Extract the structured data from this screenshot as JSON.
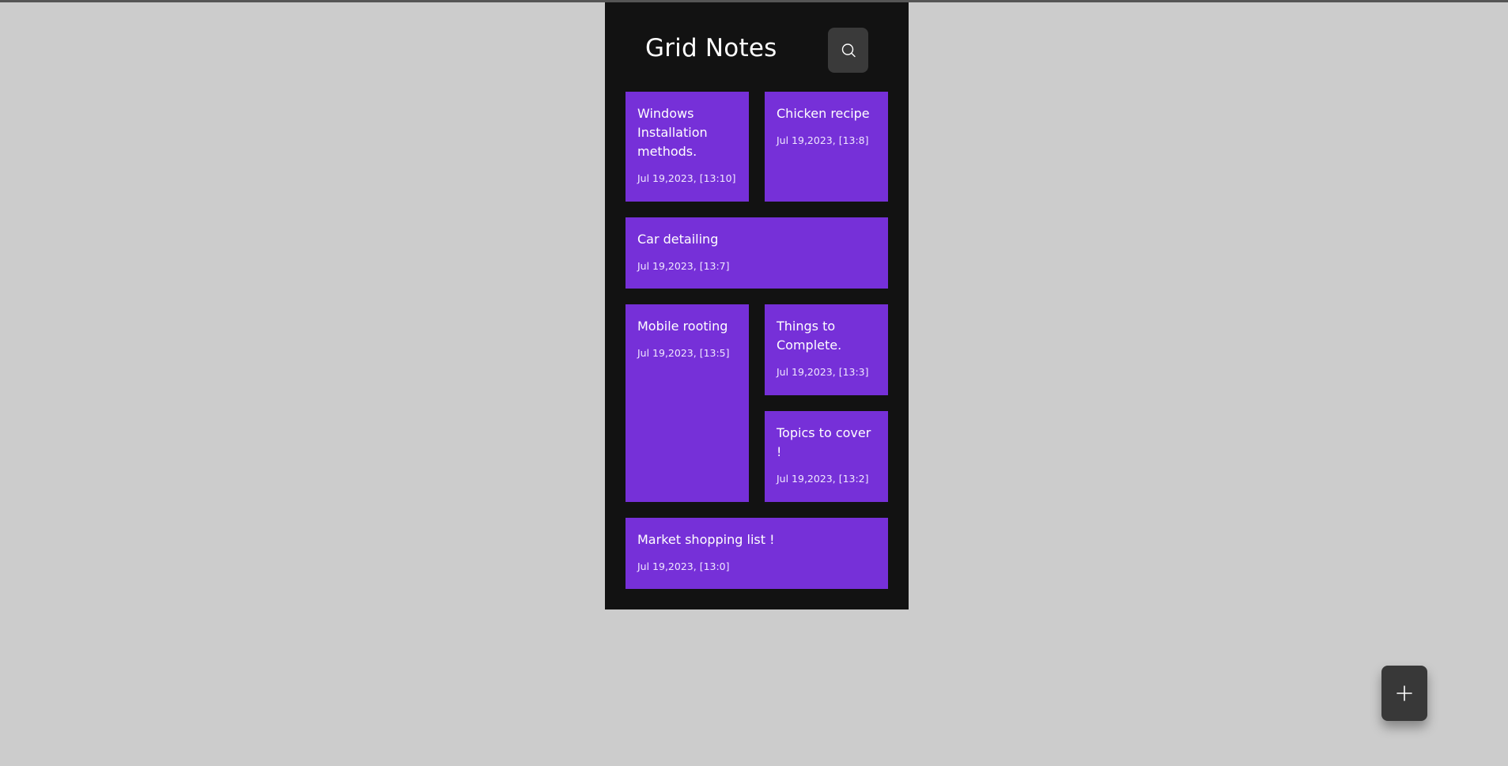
{
  "app": {
    "title": "Grid Notes"
  },
  "header": {
    "search_icon": "search-icon"
  },
  "notes": [
    {
      "title": "Windows Installation methods.",
      "date": "Jul 19,2023, [13:10]"
    },
    {
      "title": "Chicken recipe",
      "date": "Jul 19,2023, [13:8]"
    },
    {
      "title": "Car detailing",
      "date": "Jul 19,2023, [13:7]"
    },
    {
      "title": "Mobile rooting",
      "date": "Jul 19,2023, [13:5]"
    },
    {
      "title": "Things to Complete.",
      "date": "Jul 19,2023, [13:3]"
    },
    {
      "title": "Topics to cover !",
      "date": "Jul 19,2023, [13:2]"
    },
    {
      "title": "Market shopping list !",
      "date": "Jul 19,2023, [13:0]"
    }
  ],
  "fab": {
    "icon": "plus-icon"
  },
  "colors": {
    "page_background": "#cccccc",
    "app_background": "#121212",
    "note_background": "#7630d8",
    "button_background": "#3a3a3a",
    "text": "#ffffff"
  }
}
